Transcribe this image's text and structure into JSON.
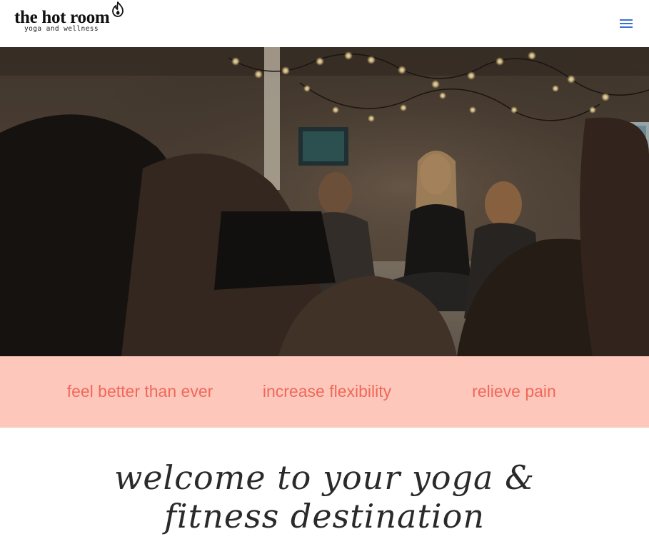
{
  "header": {
    "logo_title": "the hot room",
    "logo_subtitle": "yoga and wellness",
    "menu_icon": "hamburger-menu-icon",
    "accent_color": "#3a6fd8"
  },
  "hero": {
    "image_subject": "group-yoga-meditation-photo"
  },
  "benefits": {
    "background_color": "#fdc8bb",
    "text_color": "#f0685a",
    "items": [
      {
        "label": "feel better than ever"
      },
      {
        "label": "increase flexibility"
      },
      {
        "label": "relieve pain"
      }
    ]
  },
  "welcome": {
    "heading": "welcome to your yoga & fitness destination"
  }
}
